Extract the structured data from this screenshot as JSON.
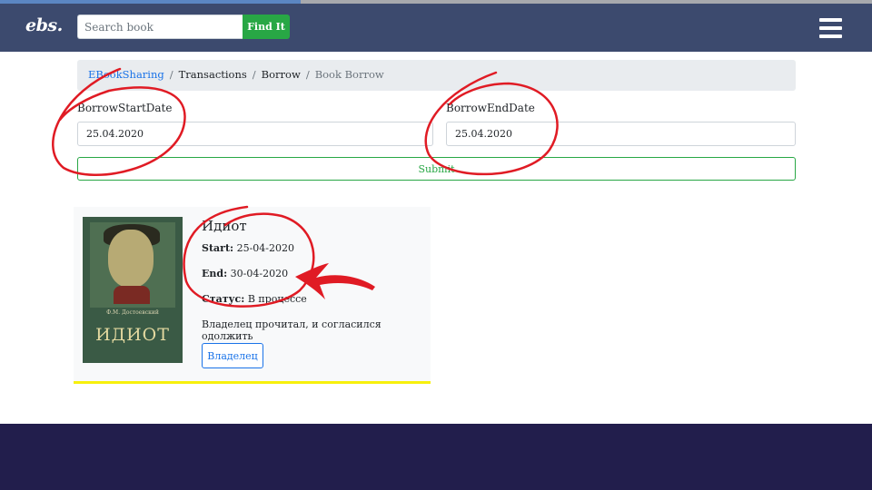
{
  "header": {
    "brand": "ebs.",
    "search_placeholder": "Search book",
    "search_button": "Find It",
    "menu_icon": "hamburger-menu-icon",
    "progress": 0.345
  },
  "breadcrumb": {
    "items": [
      "EBookSharing",
      "Transactions",
      "Borrow"
    ],
    "active": "Book Borrow",
    "separator": "/"
  },
  "form": {
    "start_label": "BorrowStartDate",
    "start_value": "25.04.2020",
    "end_label": "BorrowEndDate",
    "end_value": "25.04.2020",
    "submit_label": "Submit"
  },
  "book": {
    "title": "Идиот",
    "cover_author": "Ф.М. Достоевский",
    "cover_title": "ИДИОТ",
    "start_label": "Start:",
    "start_value": "25-04-2020",
    "end_label": "End:",
    "end_value": "30-04-2020",
    "status_label": "Статус:",
    "status_value": "В процессе",
    "note": "Владелец прочитал, и согласился одолжить",
    "owner_button": "Владелец"
  },
  "colors": {
    "navbar": "#3c4a6e",
    "footer": "#221e4c",
    "success": "#28a745",
    "link": "#1a73e8",
    "card_underline": "#f7f00d",
    "annotation": "#e01b24"
  }
}
